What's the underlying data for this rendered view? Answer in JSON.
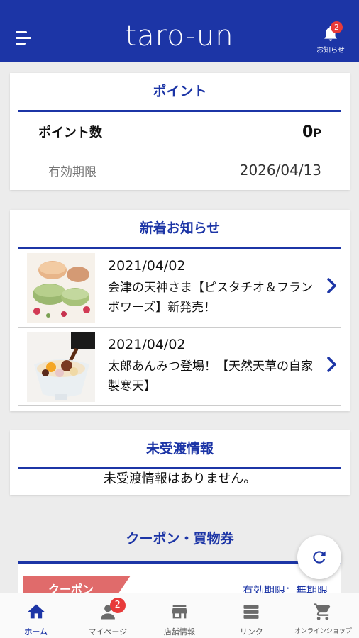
{
  "header": {
    "title": "taro-un",
    "notification_label": "お知らせ",
    "notification_badge": "2"
  },
  "points": {
    "title": "ポイント",
    "label": "ポイント数",
    "value": "0",
    "unit": "P",
    "expiry_label": "有効期限",
    "expiry_value": "2026/04/13"
  },
  "news": {
    "title": "新着お知らせ",
    "items": [
      {
        "date": "2021/04/02",
        "title": "会津の天神さま【ピスタチオ＆フランボワーズ】新発売！"
      },
      {
        "date": "2021/04/02",
        "title": "太郎あんみつ登場！【天然天草の自家製寒天】"
      }
    ]
  },
  "undelivered": {
    "title": "未受渡情報",
    "empty_text": "未受渡情報はありません。"
  },
  "coupon": {
    "title": "クーポン・買物券",
    "ribbon_label": "クーポン",
    "expiry_text": "有効期限：無期限"
  },
  "tabbar": {
    "items": [
      {
        "label": "ホーム",
        "icon": "home-icon",
        "active": true
      },
      {
        "label": "マイページ",
        "icon": "person-icon",
        "badge": "2"
      },
      {
        "label": "店舗情報",
        "icon": "store-icon"
      },
      {
        "label": "リンク",
        "icon": "list-icon"
      },
      {
        "label": "オンラインショップ",
        "icon": "cart-icon"
      }
    ]
  },
  "colors": {
    "primary": "#1c35a6",
    "badge": "#e83a3a",
    "coupon_ribbon": "#e06b6b",
    "background": "#ececec"
  }
}
